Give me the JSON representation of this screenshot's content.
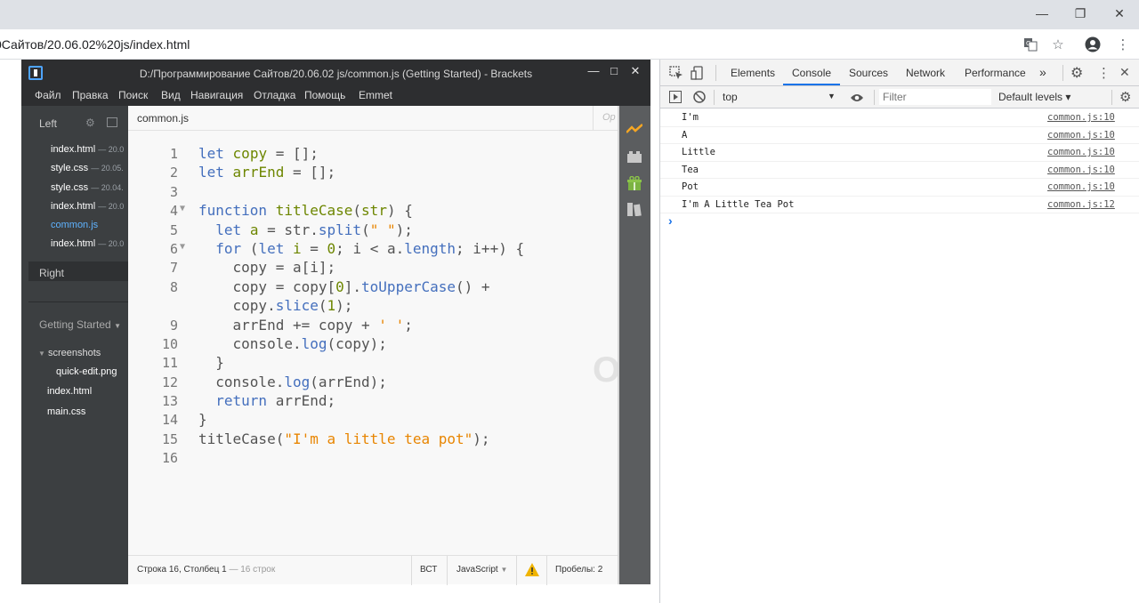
{
  "browser": {
    "url": "0Сайтов/20.06.02%20js/index.html"
  },
  "brackets": {
    "title": "D:/Программирование Сайтов/20.06.02 js/common.js (Getting Started) - Brackets",
    "menu": [
      "Файл",
      "Правка",
      "Поиск",
      "Вид",
      "Навигация",
      "Отладка",
      "Помощь",
      "Emmet"
    ],
    "sidebar": {
      "left_label": "Left",
      "files": [
        {
          "name": "index.html",
          "meta": "— 20.0"
        },
        {
          "name": "style.css",
          "meta": "— 20.05."
        },
        {
          "name": "style.css",
          "meta": "— 20.04."
        },
        {
          "name": "index.html",
          "meta": "— 20.0"
        },
        {
          "name": "common.js",
          "meta": ""
        },
        {
          "name": "index.html",
          "meta": "— 20.0"
        }
      ],
      "right_label": "Right",
      "project_label": "Getting Started",
      "tree": [
        "screenshots",
        "quick-edit.png",
        "index.html",
        "main.css"
      ]
    },
    "tab": {
      "label": "common.js",
      "right_hint": "Op"
    },
    "code_lines": [
      "let copy = [];",
      "let arrEnd = [];",
      "",
      "function titleCase(str) {",
      "  let a = str.split(\" \");",
      "  for (let i = 0; i < a.length; i++) {",
      "    copy = a[i];",
      "    copy = copy[0].toUpperCase() +",
      "    copy.slice(1);",
      "    arrEnd += copy + ' ';",
      "    console.log(copy);",
      "  }",
      "  console.log(arrEnd);",
      "  return arrEnd;",
      "}",
      "titleCase(\"I'm a little tea pot\");",
      ""
    ],
    "line_numbers": [
      "1",
      "2",
      "3",
      "4",
      "5",
      "6",
      "7",
      "8",
      "",
      "9",
      "10",
      "11",
      "12",
      "13",
      "14",
      "15",
      "16"
    ],
    "status": {
      "position": "Строка 16, Столбец 1",
      "lines": "— 16 строк",
      "insert": "ВСТ",
      "language": "JavaScript",
      "spaces": "Пробелы: 2"
    }
  },
  "devtools": {
    "tabs": [
      "Elements",
      "Console",
      "Sources",
      "Network",
      "Performance",
      "»"
    ],
    "active_tab": "Console",
    "context": "top",
    "filter_placeholder": "Filter",
    "levels": "Default levels ▾",
    "logs": [
      {
        "msg": "I'm",
        "src": "common.js:10"
      },
      {
        "msg": "A",
        "src": "common.js:10"
      },
      {
        "msg": "Little",
        "src": "common.js:10"
      },
      {
        "msg": "Tea",
        "src": "common.js:10"
      },
      {
        "msg": "Pot",
        "src": "common.js:10"
      },
      {
        "msg": "I'm A Little Tea Pot",
        "src": "common.js:12"
      }
    ],
    "prompt": "›"
  }
}
